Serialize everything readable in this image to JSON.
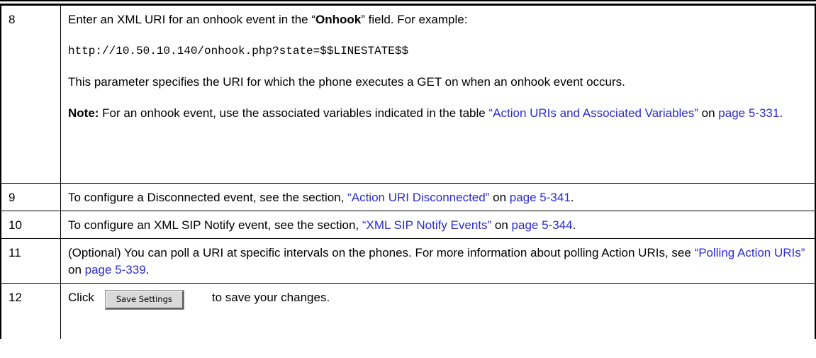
{
  "steps": [
    {
      "number": "8",
      "intro_before": "Enter an XML URI for an onhook event in the “",
      "intro_bold": "Onhook",
      "intro_after": "” field. For example:",
      "code": "http://10.50.10.140/onhook.php?state=$$LINESTATE$$",
      "description": "This parameter specifies the URI for which the phone executes a GET on when an onhook event occurs.",
      "note_label": "Note:",
      "note_text": " For an onhook event, use the associated variables indicated in the table ",
      "note_link": "“Action URIs and Associated Variables”",
      "note_on": " on ",
      "note_page": "page 5-331",
      "note_end": "."
    },
    {
      "number": "9",
      "text": "To configure a Disconnected event, see the section, ",
      "link": "“Action URI Disconnected”",
      "on": " on ",
      "page": "page 5-341",
      "end": "."
    },
    {
      "number": "10",
      "text": "To configure an XML SIP Notify event, see the section, ",
      "link": "“XML SIP Notify Events”",
      "on": " on ",
      "page": "page 5-344",
      "end": "."
    },
    {
      "number": "11",
      "text": "(Optional) You can poll a URI at specific intervals on the phones. For more information about polling Action URIs, see ",
      "link": "“Polling Action URIs”",
      "on": " on ",
      "page": "page 5-339",
      "end": "."
    },
    {
      "number": "12",
      "click": "Click",
      "button_label": "Save Settings",
      "after": "to save your changes."
    }
  ],
  "colors": {
    "link": "#2b2bd4",
    "border": "#000000",
    "button_face": "#d9d9d9"
  }
}
